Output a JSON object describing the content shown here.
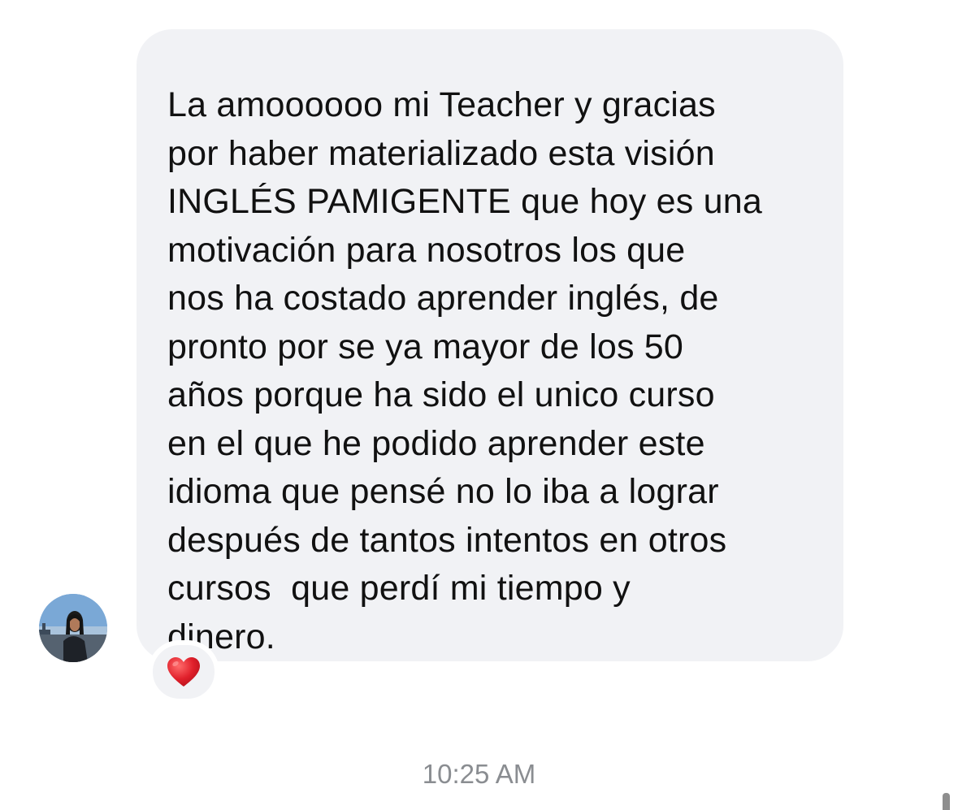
{
  "conversation": {
    "message": {
      "sender_avatar_icon": "profile-photo",
      "text_lines": [
        "La amoooooo mi Teacher y gracias",
        "por haber materializado esta visión",
        "INGLÉS PAMIGENTE que hoy es una",
        "motivación para nosotros los que",
        "nos ha costado aprender inglés, de",
        "pronto por se ya mayor de los 50",
        "años porque ha sido el unico curso",
        "en el que he podido aprender este",
        "idioma que pensé no lo iba a lograr",
        "después de tantos intentos en otros",
        "cursos  que perdí mi tiempo y",
        "dinero."
      ],
      "reaction_icon": "red-heart-icon",
      "reaction_color": "#e0202b"
    },
    "timestamp": "10:25 AM",
    "bubble_color": "#f1f2f5"
  }
}
